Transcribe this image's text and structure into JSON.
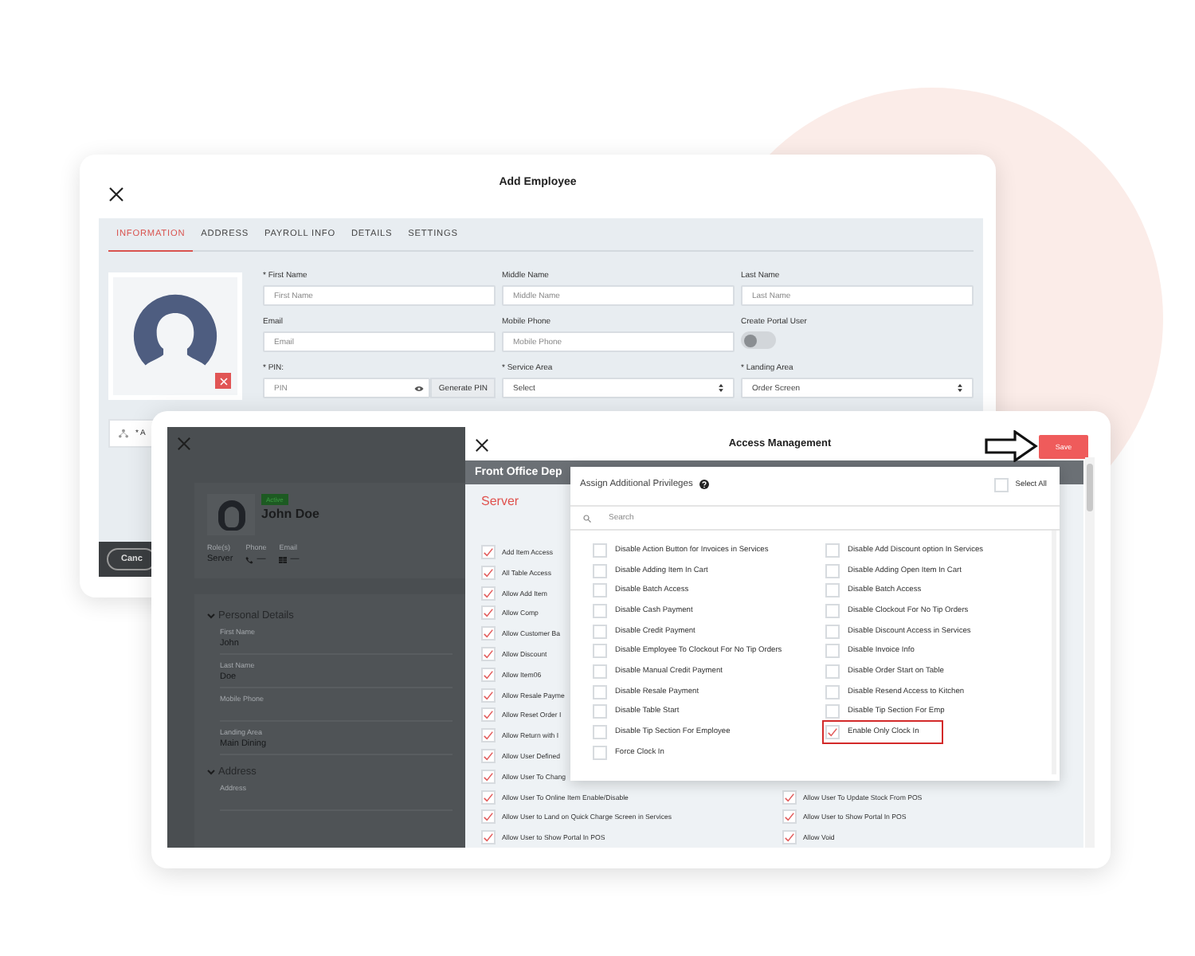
{
  "add_employee": {
    "title": "Add Employee",
    "tabs": [
      {
        "label": "INFORMATION",
        "selected": true
      },
      {
        "label": "ADDRESS",
        "selected": false
      },
      {
        "label": "PAYROLL INFO",
        "selected": false
      },
      {
        "label": "DETAILS",
        "selected": false
      },
      {
        "label": "SETTINGS",
        "selected": false
      }
    ],
    "fields": [
      {
        "kind": "text",
        "label": "* First Name",
        "placeholder": "First Name"
      },
      {
        "kind": "text",
        "label": "Middle Name",
        "placeholder": "Middle Name"
      },
      {
        "kind": "text",
        "label": "Last Name",
        "placeholder": "Last Name"
      },
      {
        "kind": "text",
        "label": "Email",
        "placeholder": "Email"
      },
      {
        "kind": "text",
        "label": "Mobile Phone",
        "placeholder": "Mobile Phone"
      },
      {
        "kind": "toggle",
        "label": "Create Portal User",
        "on": false
      },
      {
        "kind": "pin",
        "label": "* PIN:",
        "placeholder": "PIN",
        "button": "Generate PIN"
      },
      {
        "kind": "select",
        "label": "* Service Area",
        "value": "Select"
      },
      {
        "kind": "select",
        "label": "* Landing Area",
        "value": "Order Screen"
      }
    ],
    "note": "* A",
    "cancel_button": "Canc"
  },
  "employee_panel": {
    "status": "Active",
    "name": "John Doe",
    "info": [
      {
        "kind": "text",
        "label": "Role(s)",
        "value": "Server"
      },
      {
        "kind": "phone",
        "label": "Phone",
        "value": "—"
      },
      {
        "kind": "email",
        "label": "Email",
        "value": "—"
      }
    ],
    "sections": [
      {
        "title": "Personal Details",
        "expanded": true,
        "fields": [
          {
            "label": "First Name",
            "value": "John"
          },
          {
            "label": "Last Name",
            "value": "Doe"
          },
          {
            "label": "Mobile Phone"
          },
          {
            "label": "Landing Area",
            "value": "Main Dining"
          }
        ]
      },
      {
        "title": "Address",
        "expanded": true,
        "fields": [
          {
            "label": "Address"
          }
        ]
      }
    ]
  },
  "access_management": {
    "title": "Access Management",
    "save_button": "Save",
    "department": "Front Office Dep",
    "role": "Server",
    "granted_left": [
      {
        "label": "Add Item Access",
        "checked": true
      },
      {
        "label": "All Table Access",
        "checked": true
      },
      {
        "label": "Allow Add Item",
        "checked": true
      },
      {
        "label": "Allow Comp",
        "checked": true
      },
      {
        "label": "Allow Customer Ba",
        "checked": true
      },
      {
        "label": "Allow Discount",
        "checked": true
      },
      {
        "label": "Allow Item06",
        "checked": true
      },
      {
        "label": "Allow Resale Payme",
        "checked": true
      },
      {
        "label": "Allow Reset Order I",
        "checked": true
      },
      {
        "label": "Allow Return with I",
        "checked": true
      },
      {
        "label": "Allow User Defined",
        "checked": true
      },
      {
        "label": "Allow User To Chang",
        "checked": true
      },
      {
        "label": "Allow User To Online Item Enable/Disable",
        "checked": true
      },
      {
        "label": "Allow User to Land on Quick Charge Screen in Services",
        "checked": true
      },
      {
        "label": "Allow User to Show Portal In POS",
        "checked": true
      }
    ],
    "granted_right": [
      {
        "label": "Allow User To Update Stock From POS",
        "checked": true
      },
      {
        "label": "Allow User to Show Portal In POS",
        "checked": true
      },
      {
        "label": "Allow Void",
        "checked": true
      }
    ],
    "popup": {
      "title": "Assign Additional Privileges",
      "select_all": {
        "label": "Select All",
        "checked": false
      },
      "search_placeholder": "Search",
      "privileges": [
        {
          "label": "Disable Action Button for Invoices in Services",
          "checked": false,
          "highlighted": false
        },
        {
          "label": "Disable Add Discount option In Services",
          "checked": false,
          "highlighted": false
        },
        {
          "label": "Disable Adding Item In Cart",
          "checked": false,
          "highlighted": false
        },
        {
          "label": "Disable Adding Open Item In Cart",
          "checked": false,
          "highlighted": false
        },
        {
          "label": "Disable Batch Access",
          "checked": false,
          "highlighted": false
        },
        {
          "label": "Disable Batch Access",
          "checked": false,
          "highlighted": false
        },
        {
          "label": "Disable Cash Payment",
          "checked": false,
          "highlighted": false
        },
        {
          "label": "Disable Clockout For No Tip Orders",
          "checked": false,
          "highlighted": false
        },
        {
          "label": "Disable Credit Payment",
          "checked": false,
          "highlighted": false
        },
        {
          "label": "Disable Discount Access in Services",
          "checked": false,
          "highlighted": false
        },
        {
          "label": "Disable Employee To Clockout For No Tip Orders",
          "checked": false,
          "highlighted": false
        },
        {
          "label": "Disable Invoice Info",
          "checked": false,
          "highlighted": false
        },
        {
          "label": "Disable Manual Credit Payment",
          "checked": false,
          "highlighted": false
        },
        {
          "label": "Disable Order Start on Table",
          "checked": false,
          "highlighted": false
        },
        {
          "label": "Disable Resale Payment",
          "checked": false,
          "highlighted": false
        },
        {
          "label": "Disable Resend Access to Kitchen",
          "checked": false,
          "highlighted": false
        },
        {
          "label": "Disable Table Start",
          "checked": false,
          "highlighted": false
        },
        {
          "label": "Disable Tip Section For Emp",
          "checked": false,
          "highlighted": false
        },
        {
          "label": "Disable Tip Section For Employee",
          "checked": false,
          "highlighted": false
        },
        {
          "label": "Enable Only Clock In",
          "checked": true,
          "highlighted": true
        },
        {
          "label": "Force Clock In",
          "checked": false,
          "highlighted": false
        }
      ]
    }
  }
}
